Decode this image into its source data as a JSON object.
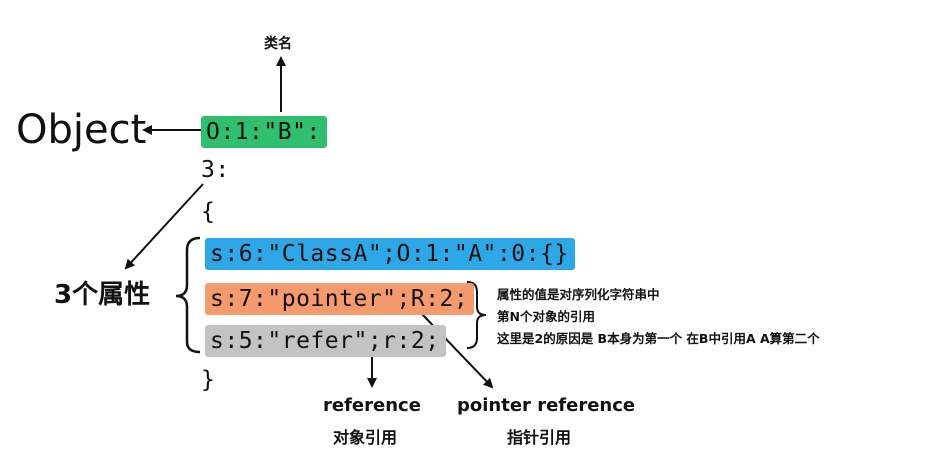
{
  "colors": {
    "green": "#2fbf6f",
    "blue": "#2ea7e6",
    "orange": "#f59a6c",
    "gray": "#c3c3c3"
  },
  "labels": {
    "class_name": "类名",
    "object": "Object",
    "object_header": "O:1:\"B\":",
    "count": "3:",
    "open_brace": "{",
    "close_brace": "}",
    "three_props": "3个属性"
  },
  "properties": [
    {
      "text": "s:6:\"ClassA\";O:1:\"A\":0:{}",
      "color": "blue"
    },
    {
      "text": "s:7:\"pointer\";R:2;",
      "color": "orange"
    },
    {
      "text": "s:5:\"refer\";r:2;",
      "color": "gray"
    }
  ],
  "note": {
    "line1": "属性的值是对序列化字符串中",
    "line2": "第N个对象的引用",
    "line3": "这里是2的原因是 B本身为第一个 在B中引用A A算第二个"
  },
  "reference": {
    "title": "reference",
    "subtitle": "对象引用"
  },
  "pointer_reference": {
    "title": "pointer reference",
    "subtitle": "指针引用"
  }
}
